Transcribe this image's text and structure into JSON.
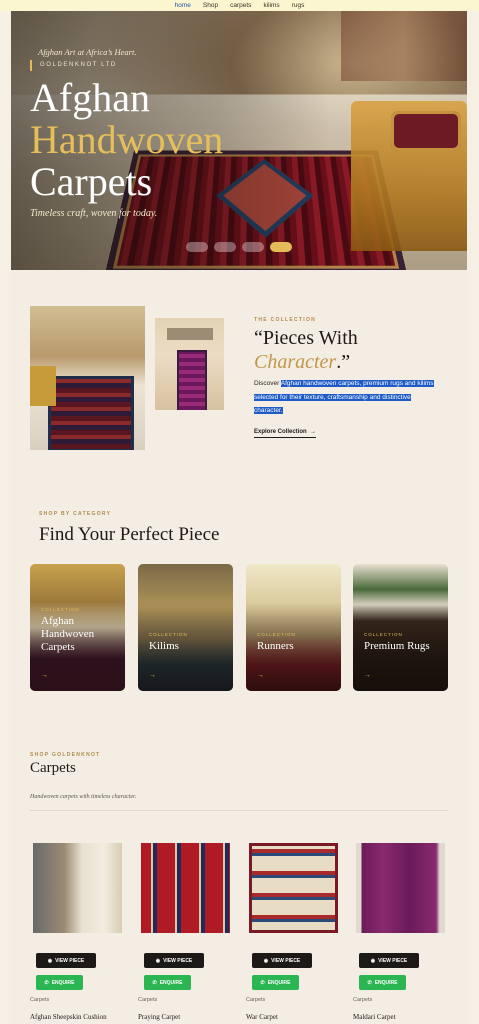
{
  "nav": {
    "items": [
      "home",
      "Shop",
      "carpets",
      "kilims",
      "rugs"
    ]
  },
  "hero": {
    "tagline": "Afghan Art at Africa’s Heart.",
    "brand": "GOLDENKNOT LTD",
    "title_line1": "Afghan",
    "title_line2": "Handwoven",
    "title_line3": "Carpets",
    "subtitle": "Timeless craft, woven for today.",
    "active_slide": 4,
    "slide_count": 4
  },
  "collection": {
    "eyebrow": "THE COLLECTION",
    "title_a": "“Pieces With",
    "title_b": "Character",
    "title_c": ".”",
    "desc_lead": "Discover ",
    "desc_highlight": "Afghan handwoven carpets, premium rugs and kilims selected for their texture, craftsmanship and distinctive character.",
    "cta": "Explore Collection",
    "cta_icon": "arrow-right-icon"
  },
  "categories": {
    "eyebrow": "SHOP BY CATEGORY",
    "title": "Find Your Perfect Piece",
    "items": [
      {
        "label": "COLLECTION",
        "name": "Afghan Handwoven Carpets"
      },
      {
        "label": "COLLECTION",
        "name": "Kilims"
      },
      {
        "label": "COLLECTION",
        "name": "Runners"
      },
      {
        "label": "COLLECTION",
        "name": "Premium Rugs"
      }
    ]
  },
  "shop": {
    "eyebrow": "SHOP GOLDENKNOT",
    "title": "Carpets",
    "subtitle": "Handwoven carpets with timeless character.",
    "view_label": "VIEW PIECE",
    "enquire_label": "ENQUIRE",
    "products": [
      {
        "category": "Carpets",
        "name": "Afghan Sheepskin Cushion"
      },
      {
        "category": "Carpets",
        "name": "Praying Carpet"
      },
      {
        "category": "Carpets",
        "name": "War Carpet"
      },
      {
        "category": "Carpets",
        "name": "Maldari Carpet"
      }
    ]
  },
  "colors": {
    "accent_gold": "#e3bb59",
    "whatsapp_green": "#2bb653",
    "highlight_blue": "#1e5bc6",
    "background": "#f4ede4"
  }
}
